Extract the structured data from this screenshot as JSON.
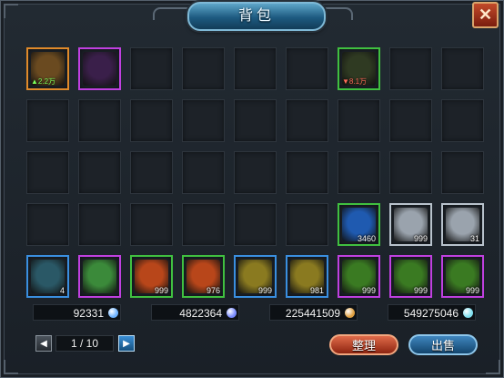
{
  "window": {
    "title": "背包",
    "close_label": "✕"
  },
  "colors": {
    "panel_bg": "#1b2128",
    "title_blue": "#1d5a80",
    "sort_button": "#c24a2a",
    "sell_button": "#2f6fa3",
    "rarity_orange": "#e08a2a",
    "rarity_purple": "#c040e0",
    "rarity_green": "#40c040",
    "rarity_blue": "#3a8fe0",
    "rarity_white": "#b8c2cc"
  },
  "inventory": {
    "rows": 5,
    "cols": 9,
    "items": [
      {
        "row": 0,
        "col": 0,
        "rarity": "orange",
        "icon": "armor-icon",
        "tag": "2.2万",
        "arrow": "up",
        "bg": "#6a4a20"
      },
      {
        "row": 0,
        "col": 1,
        "rarity": "purple",
        "icon": "wing-helm-icon",
        "bg": "#3a1f4a"
      },
      {
        "row": 0,
        "col": 6,
        "rarity": "green",
        "icon": "helmet-icon",
        "tag": "8.1万",
        "arrow": "down",
        "bg": "#2f3a22"
      },
      {
        "row": 3,
        "col": 6,
        "rarity": "green",
        "icon": "blue-gem-icon",
        "count": "3460",
        "bg": "#1f5ab0"
      },
      {
        "row": 3,
        "col": 7,
        "rarity": "white",
        "icon": "scroll-icon",
        "count": "999",
        "bg": "#9aa3ad"
      },
      {
        "row": 3,
        "col": 8,
        "rarity": "white",
        "icon": "scroll-icon",
        "count": "31",
        "bg": "#9aa3ad"
      },
      {
        "row": 4,
        "col": 0,
        "rarity": "blue",
        "icon": "crystal-ore-icon",
        "count": "4",
        "bg": "#2a5866"
      },
      {
        "row": 4,
        "col": 1,
        "rarity": "purple",
        "icon": "green-crystal-icon",
        "bg": "#3b8a3a"
      },
      {
        "row": 4,
        "col": 2,
        "rarity": "green",
        "icon": "red-flower-icon",
        "count": "999",
        "bg": "#b8461a"
      },
      {
        "row": 4,
        "col": 3,
        "rarity": "green",
        "icon": "red-flower-icon",
        "count": "976",
        "bg": "#b8461a"
      },
      {
        "row": 4,
        "col": 4,
        "rarity": "blue",
        "icon": "gold-ring-icon",
        "count": "999",
        "bg": "#8a7a20"
      },
      {
        "row": 4,
        "col": 5,
        "rarity": "blue",
        "icon": "gold-ring-icon",
        "count": "981",
        "bg": "#8a7a20"
      },
      {
        "row": 4,
        "col": 6,
        "rarity": "purple",
        "icon": "green-pod-icon",
        "count": "999",
        "bg": "#3a7a22"
      },
      {
        "row": 4,
        "col": 7,
        "rarity": "purple",
        "icon": "green-pod-icon",
        "count": "999",
        "bg": "#3a7a22"
      },
      {
        "row": 4,
        "col": 8,
        "rarity": "purple",
        "icon": "green-pod-icon",
        "count": "999",
        "bg": "#3a7a22"
      }
    ]
  },
  "currencies": [
    {
      "value": "92331",
      "icon": "blue-crystal-currency-icon",
      "color": "#6fb4ff"
    },
    {
      "value": "4822364",
      "icon": "purple-crystal-currency-icon",
      "color": "#7a8cff"
    },
    {
      "value": "225441509",
      "icon": "gold-coin-icon",
      "color": "#e0a040"
    },
    {
      "value": "549275046",
      "icon": "cyan-spark-currency-icon",
      "color": "#7fe0f0"
    }
  ],
  "pager": {
    "text": "1 / 10",
    "prev_label": "◀",
    "next_label": "▶"
  },
  "buttons": {
    "sort_label": "整理",
    "sell_label": "出售"
  }
}
